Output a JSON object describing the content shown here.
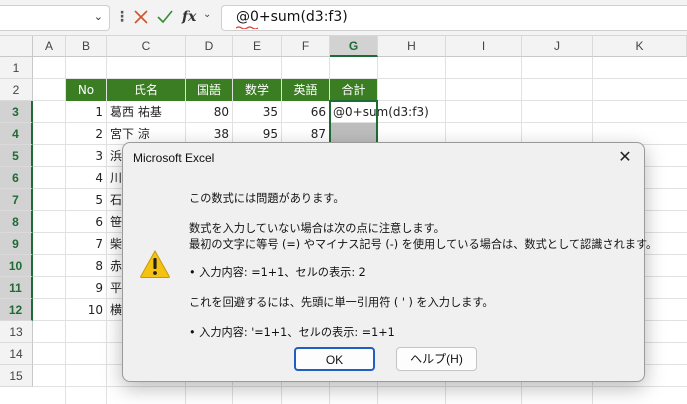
{
  "formula_bar": {
    "name_box": "",
    "fx_label": "fx",
    "formula_text": "@0+sum(d3:f3)"
  },
  "columns": [
    "A",
    "B",
    "C",
    "D",
    "E",
    "F",
    "G",
    "H",
    "I",
    "J",
    "K"
  ],
  "rows": [
    "1",
    "2",
    "3",
    "4",
    "5",
    "6",
    "7",
    "8",
    "9",
    "10",
    "11",
    "12",
    "13",
    "14",
    "15"
  ],
  "table": {
    "headers": [
      "No",
      "氏名",
      "国語",
      "数学",
      "英語",
      "合計"
    ],
    "rows": [
      {
        "no": "1",
        "name": "葛西 祐基",
        "kokugo": "80",
        "sugaku": "35",
        "eigo": "66",
        "total": "@0+sum(d3:f3)"
      },
      {
        "no": "2",
        "name": "宮下 涼",
        "kokugo": "38",
        "sugaku": "95",
        "eigo": "87",
        "total": ""
      },
      {
        "no": "3",
        "name": "浜",
        "kokugo": "",
        "sugaku": "",
        "eigo": "",
        "total": ""
      },
      {
        "no": "4",
        "name": "川",
        "kokugo": "",
        "sugaku": "",
        "eigo": "",
        "total": ""
      },
      {
        "no": "5",
        "name": "石",
        "kokugo": "",
        "sugaku": "",
        "eigo": "",
        "total": ""
      },
      {
        "no": "6",
        "name": "笹",
        "kokugo": "",
        "sugaku": "",
        "eigo": "",
        "total": ""
      },
      {
        "no": "7",
        "name": "柴",
        "kokugo": "",
        "sugaku": "",
        "eigo": "",
        "total": ""
      },
      {
        "no": "8",
        "name": "赤",
        "kokugo": "",
        "sugaku": "",
        "eigo": "",
        "total": ""
      },
      {
        "no": "9",
        "name": "平",
        "kokugo": "",
        "sugaku": "",
        "eigo": "",
        "total": ""
      },
      {
        "no": "10",
        "name": "横",
        "kokugo": "",
        "sugaku": "",
        "eigo": "",
        "total": ""
      }
    ]
  },
  "dialog": {
    "title": "Microsoft Excel",
    "close_glyph": "✕",
    "line1": "この数式には問題があります。",
    "line2": "数式を入力していない場合は次の点に注意します。",
    "line3": "最初の文字に等号 (=) やマイナス記号 (-) を使用している場合は、数式として認識されます。",
    "line4": "• 入力内容: =1+1、セルの表示: 2",
    "line5": "これを回避するには、先頭に単一引用符 ( ' ) を入力します。",
    "line6": "• 入力内容: '=1+1、セルの表示: =1+1",
    "ok_label": "OK",
    "help_label": "ヘルプ(H)"
  },
  "colors": {
    "header_green": "#3a7d22",
    "selection_green": "#1e6b35",
    "warning_yellow": "#f5c211",
    "ok_border": "#1f5fbf"
  }
}
